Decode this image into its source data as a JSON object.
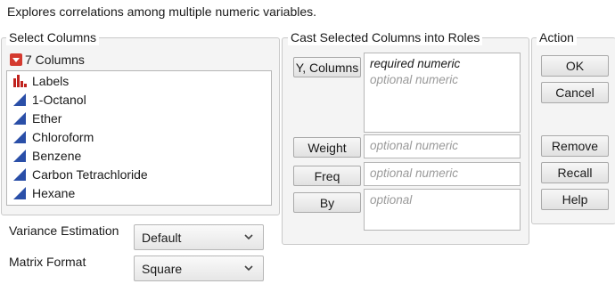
{
  "description": "Explores correlations among multiple numeric variables.",
  "select_columns": {
    "title": "Select Columns",
    "count_label": "7 Columns",
    "items": [
      {
        "label": "Labels",
        "icon": "nominal-bar-icon"
      },
      {
        "label": "1-Octanol",
        "icon": "continuous-triangle-icon"
      },
      {
        "label": "Ether",
        "icon": "continuous-triangle-icon"
      },
      {
        "label": "Chloroform",
        "icon": "continuous-triangle-icon"
      },
      {
        "label": "Benzene",
        "icon": "continuous-triangle-icon"
      },
      {
        "label": "Carbon Tetrachloride",
        "icon": "continuous-triangle-icon"
      },
      {
        "label": "Hexane",
        "icon": "continuous-triangle-icon"
      }
    ]
  },
  "cast_roles": {
    "title": "Cast Selected Columns into Roles",
    "y_columns": {
      "button": "Y, Columns",
      "line1": "required numeric",
      "line2": "optional numeric"
    },
    "weight": {
      "button": "Weight",
      "placeholder": "optional numeric"
    },
    "freq": {
      "button": "Freq",
      "placeholder": "optional numeric"
    },
    "by": {
      "button": "By",
      "placeholder": "optional"
    }
  },
  "action": {
    "title": "Action",
    "ok": "OK",
    "cancel": "Cancel",
    "remove": "Remove",
    "recall": "Recall",
    "help": "Help"
  },
  "options": {
    "variance_label": "Variance Estimation",
    "variance_value": "Default",
    "matrix_label": "Matrix Format",
    "matrix_value": "Square"
  },
  "colors": {
    "nominal_icon": "#c0231e",
    "continuous_icon": "#2a4fa8",
    "disclosure": "#d43a2f"
  }
}
